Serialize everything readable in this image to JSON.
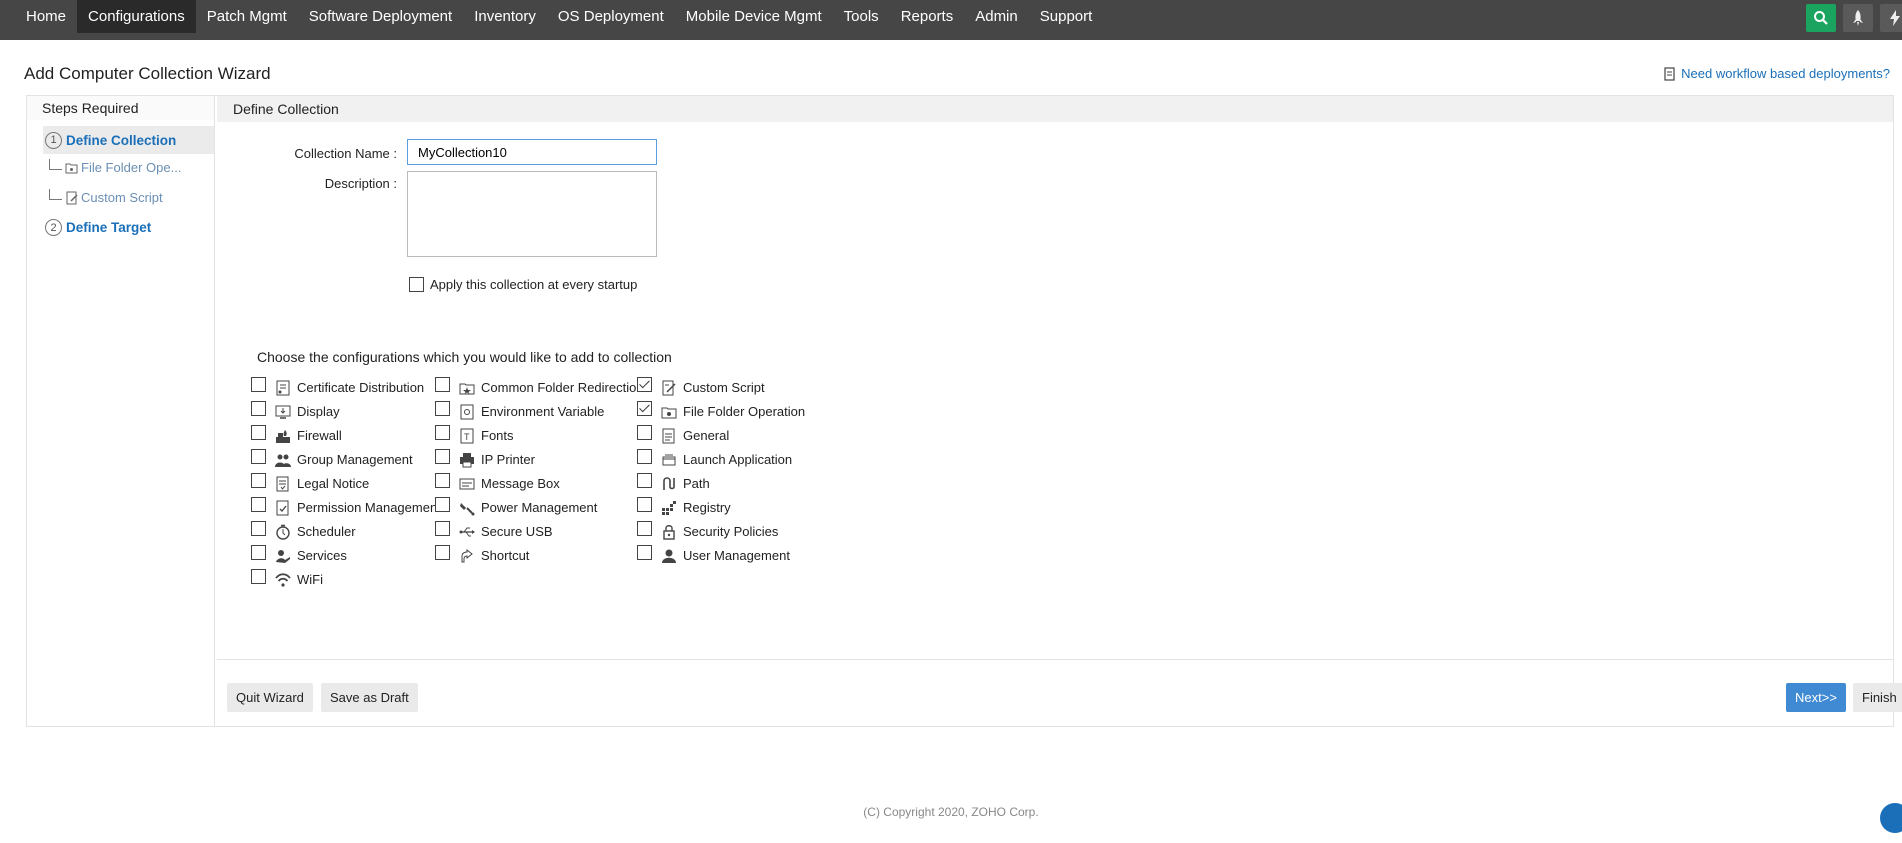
{
  "nav": {
    "items": [
      "Home",
      "Configurations",
      "Patch Mgmt",
      "Software Deployment",
      "Inventory",
      "OS Deployment",
      "Mobile Device Mgmt",
      "Tools",
      "Reports",
      "Admin",
      "Support"
    ],
    "active": "Configurations"
  },
  "wizard": {
    "title": "Add Computer Collection Wizard",
    "help_link": "Need workflow based deployments?"
  },
  "steps": {
    "header": "Steps Required",
    "step1_num": "1",
    "step1_label": "Define Collection",
    "sub1": "File Folder Ope...",
    "sub2": "Custom Script",
    "step2_num": "2",
    "step2_label": "Define Target"
  },
  "form": {
    "header": "Define Collection",
    "name_label": "Collection Name :",
    "name_value": "MyCollection10",
    "desc_label": "Description :",
    "startup_label": "Apply this collection at every startup",
    "choose_text": "Choose the configurations which you would like to add to collection"
  },
  "configs": [
    {
      "label": "Certificate Distribution",
      "icon": "certificate-icon",
      "checked": false
    },
    {
      "label": "Common Folder Redirection",
      "icon": "folder-redirect-icon",
      "checked": false
    },
    {
      "label": "Custom Script",
      "icon": "script-icon",
      "checked": true
    },
    {
      "label": "Display",
      "icon": "display-icon",
      "checked": false
    },
    {
      "label": "Environment Variable",
      "icon": "env-variable-icon",
      "checked": false
    },
    {
      "label": "File Folder Operation",
      "icon": "file-folder-icon",
      "checked": true
    },
    {
      "label": "Firewall",
      "icon": "firewall-icon",
      "checked": false
    },
    {
      "label": "Fonts",
      "icon": "fonts-icon",
      "checked": false
    },
    {
      "label": "General",
      "icon": "general-icon",
      "checked": false
    },
    {
      "label": "Group Management",
      "icon": "group-icon",
      "checked": false
    },
    {
      "label": "IP Printer",
      "icon": "printer-icon",
      "checked": false
    },
    {
      "label": "Launch Application",
      "icon": "launch-app-icon",
      "checked": false
    },
    {
      "label": "Legal Notice",
      "icon": "legal-notice-icon",
      "checked": false
    },
    {
      "label": "Message Box",
      "icon": "message-box-icon",
      "checked": false
    },
    {
      "label": "Path",
      "icon": "path-icon",
      "checked": false
    },
    {
      "label": "Permission Management",
      "icon": "permission-icon",
      "checked": false
    },
    {
      "label": "Power Management",
      "icon": "power-icon",
      "checked": false
    },
    {
      "label": "Registry",
      "icon": "registry-icon",
      "checked": false
    },
    {
      "label": "Scheduler",
      "icon": "scheduler-icon",
      "checked": false
    },
    {
      "label": "Secure USB",
      "icon": "usb-icon",
      "checked": false
    },
    {
      "label": "Security Policies",
      "icon": "lock-icon",
      "checked": false
    },
    {
      "label": "Services",
      "icon": "services-icon",
      "checked": false
    },
    {
      "label": "Shortcut",
      "icon": "shortcut-icon",
      "checked": false
    },
    {
      "label": "User Management",
      "icon": "user-icon",
      "checked": false
    },
    {
      "label": "WiFi",
      "icon": "wifi-icon",
      "checked": false
    }
  ],
  "buttons": {
    "quit": "Quit Wizard",
    "draft": "Save as Draft",
    "next": "Next>>",
    "finish": "Finish"
  },
  "footer": {
    "copyright": "(C) Copyright 2020, ZOHO Corp."
  },
  "colors": {
    "nav_bg": "#464646",
    "link": "#1a6fb8",
    "search_btn": "#1aa45f",
    "next_btn": "#3f8ad2"
  }
}
